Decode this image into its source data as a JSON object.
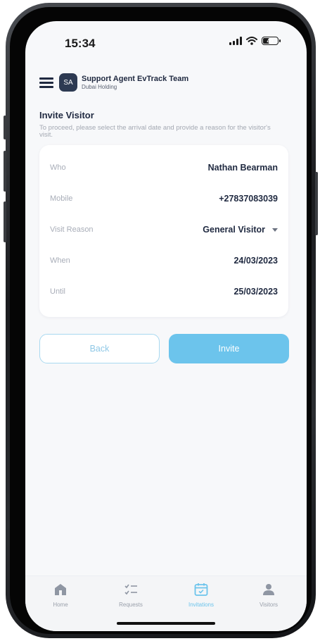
{
  "status_bar": {
    "time": "15:34",
    "battery_level": "40",
    "battery_fraction": 0.4
  },
  "header": {
    "avatar_initials": "SA",
    "title": "Support Agent EvTrack Team",
    "subtitle": "Dubai Holding"
  },
  "page": {
    "title": "Invite Visitor",
    "description": "To proceed, please select the arrival date and provide a reason for the visitor's visit."
  },
  "form": {
    "rows": [
      {
        "label": "Who",
        "value": "Nathan Bearman"
      },
      {
        "label": "Mobile",
        "value": "+27837083039"
      },
      {
        "label": "Visit Reason",
        "value": "General Visitor"
      },
      {
        "label": "When",
        "value": "24/03/2023"
      },
      {
        "label": "Until",
        "value": "25/03/2023"
      }
    ]
  },
  "actions": {
    "back_label": "Back",
    "invite_label": "Invite"
  },
  "bottom_nav": {
    "items": [
      {
        "label": "Home",
        "icon": "home-icon"
      },
      {
        "label": "Requests",
        "icon": "checklist-icon"
      },
      {
        "label": "Invitations",
        "icon": "calendar-check-icon"
      },
      {
        "label": "Visitors",
        "icon": "person-icon"
      }
    ],
    "active_index": 2
  },
  "colors": {
    "accent": "#6cc4ec",
    "text_primary": "#1f2940",
    "text_muted": "#a8adb8",
    "background": "#f7f8fa"
  }
}
